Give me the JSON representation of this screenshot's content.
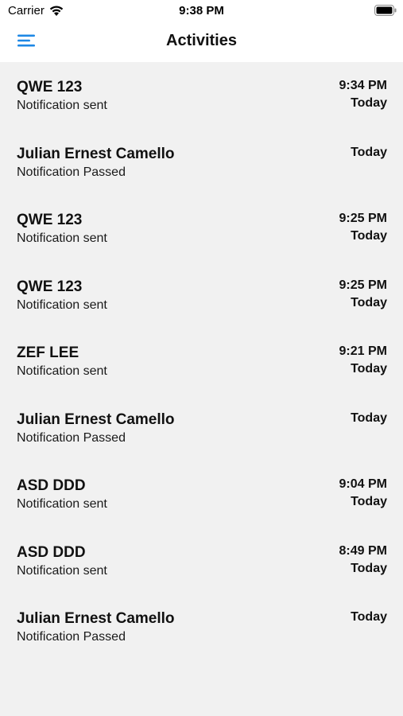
{
  "status_bar": {
    "carrier": "Carrier",
    "time": "9:38 PM",
    "wifi_icon": "wifi-icon",
    "battery_icon": "battery-icon"
  },
  "nav": {
    "title": "Activities",
    "menu_icon": "hamburger-menu-icon",
    "accent_color": "#1e88e5"
  },
  "activities": [
    {
      "title": "QWE 123",
      "subtitle": "Notification sent",
      "time": "9:34 PM",
      "day": "Today"
    },
    {
      "title": "Julian Ernest Camello",
      "subtitle": "Notification Passed",
      "time": "",
      "day": "Today"
    },
    {
      "title": "QWE 123",
      "subtitle": "Notification sent",
      "time": "9:25 PM",
      "day": "Today"
    },
    {
      "title": "QWE 123",
      "subtitle": "Notification sent",
      "time": "9:25 PM",
      "day": "Today"
    },
    {
      "title": "ZEF LEE",
      "subtitle": "Notification sent",
      "time": "9:21 PM",
      "day": "Today"
    },
    {
      "title": "Julian Ernest Camello",
      "subtitle": "Notification Passed",
      "time": "",
      "day": "Today"
    },
    {
      "title": "ASD DDD",
      "subtitle": "Notification sent",
      "time": "9:04 PM",
      "day": "Today"
    },
    {
      "title": "ASD DDD",
      "subtitle": "Notification sent",
      "time": "8:49 PM",
      "day": "Today"
    },
    {
      "title": "Julian Ernest Camello",
      "subtitle": "Notification Passed",
      "time": "",
      "day": "Today"
    }
  ]
}
